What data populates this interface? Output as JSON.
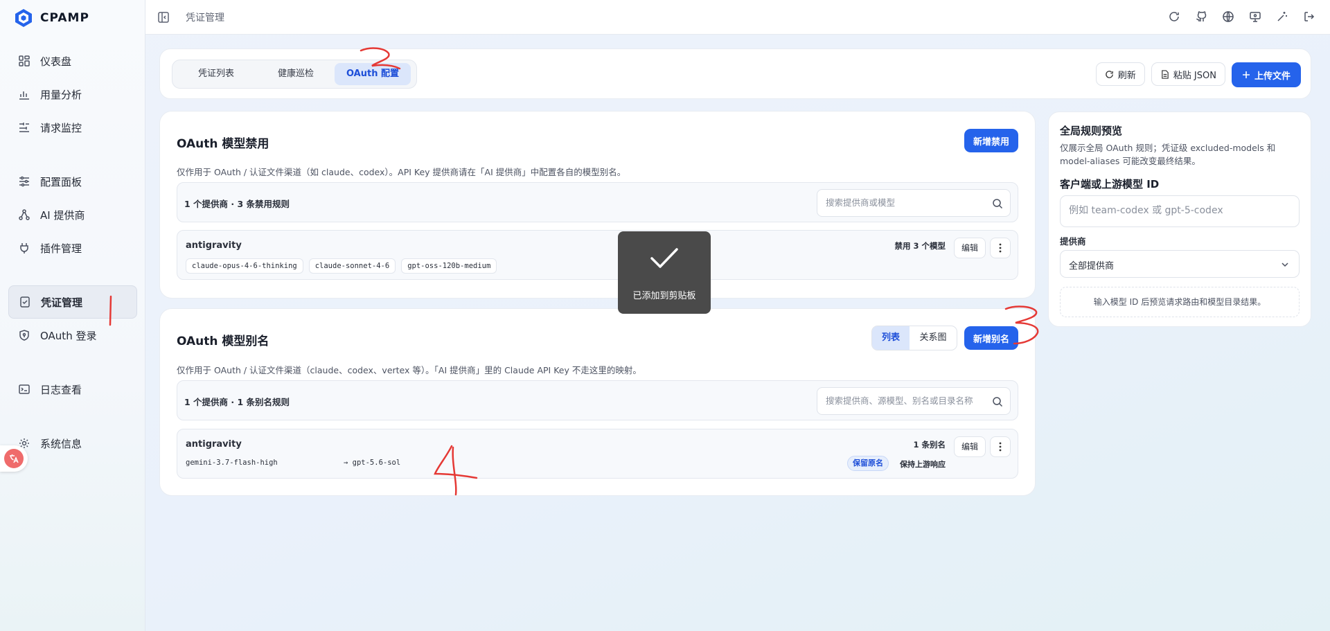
{
  "app": {
    "name": "CPAMP",
    "breadcrumb": "凭证管理"
  },
  "sidebar": {
    "items": [
      {
        "label": "仪表盘",
        "icon": "dashboard-icon"
      },
      {
        "label": "用量分析",
        "icon": "bar-chart-icon"
      },
      {
        "label": "请求监控",
        "icon": "sliders-icon"
      },
      {
        "label": "配置面板",
        "icon": "settings-sliders-icon"
      },
      {
        "label": "AI 提供商",
        "icon": "network-icon"
      },
      {
        "label": "插件管理",
        "icon": "plug-icon"
      },
      {
        "label": "凭证管理",
        "icon": "file-check-icon",
        "active": true
      },
      {
        "label": "OAuth 登录",
        "icon": "shield-icon"
      },
      {
        "label": "日志查看",
        "icon": "terminal-icon"
      },
      {
        "label": "系统信息",
        "icon": "settings-icon"
      }
    ]
  },
  "tabs": [
    "凭证列表",
    "健康巡检",
    "OAuth 配置"
  ],
  "toolbar": {
    "refresh": "刷新",
    "paste_json": "粘贴 JSON",
    "upload": "上传文件"
  },
  "exclusions": {
    "title": "OAuth 模型禁用",
    "add_button": "新增禁用",
    "description": "仅作用于 OAuth / 认证文件渠道（如 claude、codex）。API Key 提供商请在「AI 提供商」中配置各自的模型别名。",
    "summary": "1 个提供商 · 3 条禁用规则",
    "search_placeholder": "搜索提供商或模型",
    "row": {
      "name": "antigravity",
      "meta": "禁用 3 个模型",
      "edit": "编辑",
      "models": [
        "claude-opus-4-6-thinking",
        "claude-sonnet-4-6",
        "gpt-oss-120b-medium"
      ]
    }
  },
  "aliases": {
    "title": "OAuth 模型别名",
    "view_list": "列表",
    "view_graph": "关系图",
    "add_button": "新增别名",
    "description": "仅作用于 OAuth / 认证文件渠道（claude、codex、vertex 等）。「AI 提供商」里的 Claude API Key 不走这里的映射。",
    "summary": "1 个提供商 · 1 条别名规则",
    "search_placeholder": "搜索提供商、源模型、别名或目录名称",
    "row": {
      "name": "antigravity",
      "meta": "1 条别名",
      "edit": "编辑",
      "source": "gemini-3.7-flash-high",
      "target": "→ gpt-5.6-sol",
      "badge_keep_name": "保留原名",
      "badge_keep_upstream": "保持上游响应"
    }
  },
  "preview": {
    "title": "全局规则预览",
    "description": "仅展示全局 OAuth 规则；凭证级 excluded-models 和 model-aliases 可能改变最终结果。",
    "model_label": "客户端或上游模型 ID",
    "model_placeholder": "例如 team-codex 或 gpt-5-codex",
    "provider_label": "提供商",
    "provider_value": "全部提供商",
    "hint": "输入模型 ID 后预览请求路由和模型目录结果。"
  },
  "toast": {
    "message": "已添加到剪贴板"
  },
  "annotations": {
    "mark_3": "3",
    "mark_4": "4"
  },
  "colors": {
    "primary": "#2563eb",
    "annotation": "#e53935"
  }
}
